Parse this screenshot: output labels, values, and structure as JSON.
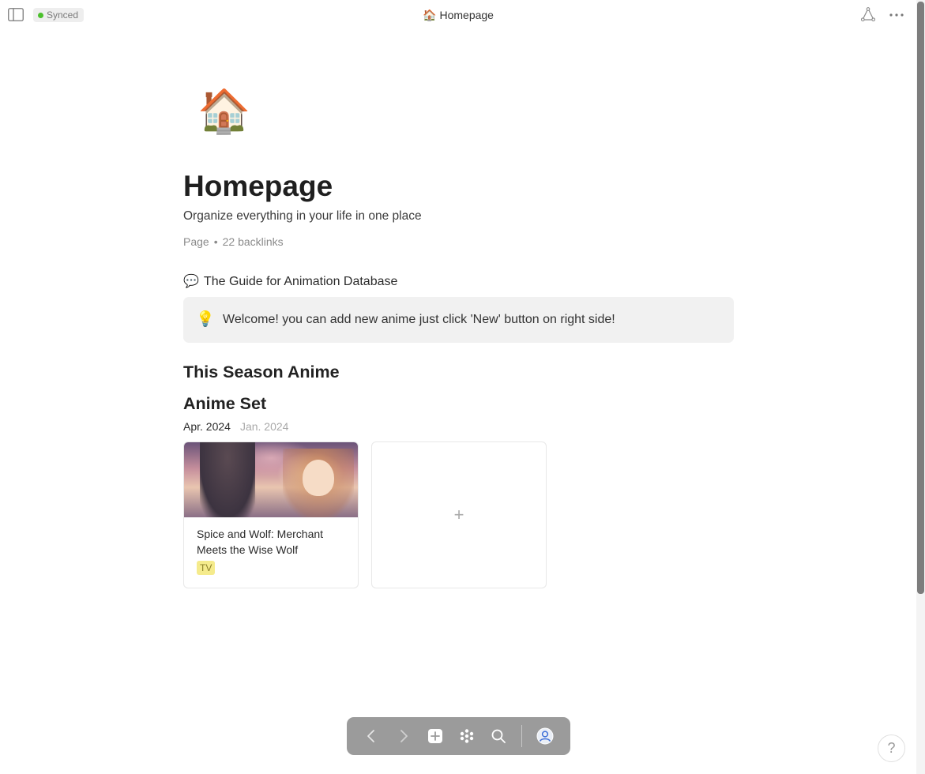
{
  "topbar": {
    "sync_status": "Synced",
    "doc_icon": "🏠",
    "doc_title": "Homepage"
  },
  "page": {
    "icon": "🏠",
    "title": "Homepage",
    "description": "Organize everything in your life in one place",
    "meta_type": "Page",
    "meta_separator": "•",
    "meta_backlinks": "22 backlinks"
  },
  "guide": {
    "icon": "💬",
    "text": "The Guide for Animation Database"
  },
  "callout": {
    "icon": "💡",
    "text": "Welcome! you can add new anime just click 'New' button on right side!"
  },
  "sections": {
    "season_heading": "This Season Anime",
    "set_heading": "Anime Set"
  },
  "tabs": [
    {
      "label": "Apr. 2024",
      "active": true
    },
    {
      "label": "Jan. 2024",
      "active": false
    }
  ],
  "cards": [
    {
      "title": "Spice and Wolf: Merchant Meets the Wise Wolf",
      "tag": "TV"
    }
  ],
  "add_card": {
    "label": "+"
  },
  "help": {
    "label": "?"
  },
  "icons": {
    "sidebar": "sidebar-toggle-icon",
    "share": "share-graph-icon",
    "more": "more-horizontal-icon",
    "back": "chevron-left-icon",
    "forward": "chevron-right-icon",
    "new": "plus-square-icon",
    "apps": "apps-dots-icon",
    "search": "search-icon",
    "account": "user-circle-icon"
  },
  "colors": {
    "synced_dot": "#4bc02d",
    "tag_bg": "#f5eb8c",
    "callout_bg": "#f1f1f1",
    "toolbar_bg": "#9b9b9b"
  }
}
